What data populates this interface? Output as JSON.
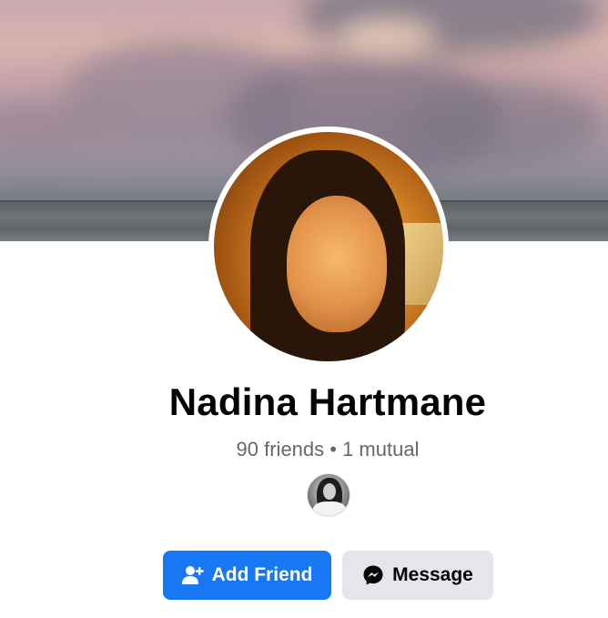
{
  "profile": {
    "name": "Nadina Hartmane",
    "friends_text": "90 friends • 1 mutual"
  },
  "actions": {
    "add_friend_label": "Add Friend",
    "message_label": "Message"
  },
  "icons": {
    "add_friend": "add-friend-icon",
    "message": "messenger-icon"
  },
  "colors": {
    "primary_button": "#1877f2",
    "secondary_button": "#e4e6eb",
    "name_text": "#050505",
    "secondary_text": "#65676b"
  }
}
